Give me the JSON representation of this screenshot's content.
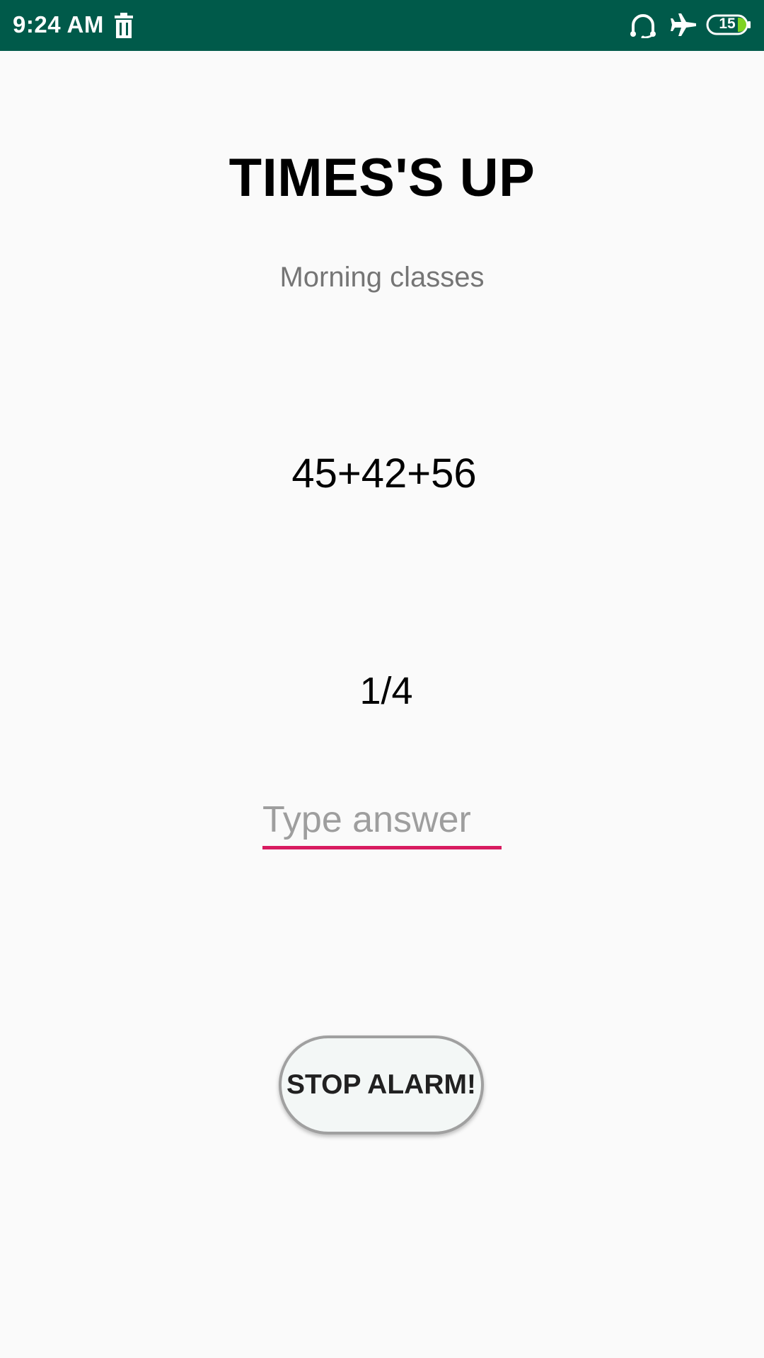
{
  "status_bar": {
    "time": "9:24 AM",
    "battery_level": "15",
    "icons": [
      "trash-icon",
      "headset-icon",
      "airplane-mode-icon",
      "battery-icon"
    ],
    "background_color": "#005a4a"
  },
  "main": {
    "title": "TIMES'S UP",
    "subtitle": "Morning classes",
    "problem": "45+42+56",
    "progress": "1/4",
    "answer": {
      "value": "",
      "placeholder": "Type answer",
      "underline_color": "#d81b60"
    },
    "stop_button_label": "STOP ALARM!"
  }
}
